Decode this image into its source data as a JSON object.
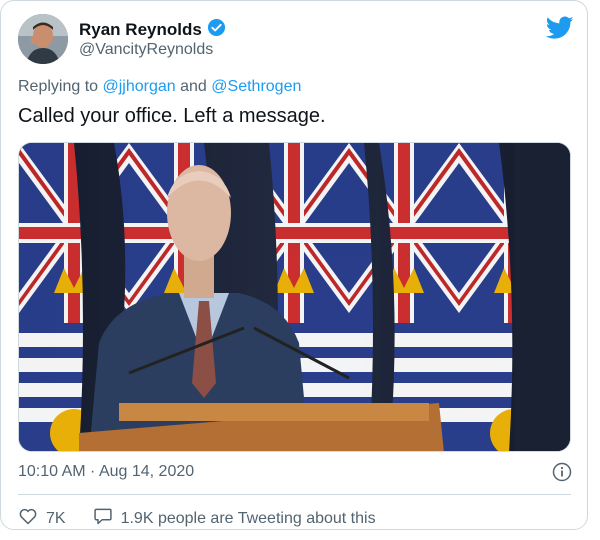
{
  "tweet": {
    "display_name": "Ryan Reynolds",
    "handle": "@VancityReynolds",
    "reply_prefix": "Replying to",
    "reply_user1": "@jjhorgan",
    "reply_and": "and",
    "reply_user2": "@Sethrogen",
    "text": "Called your office. Left a message.",
    "timestamp": "10:10 AM · Aug 14, 2020",
    "likes": "7K",
    "conversation": "1.9K people are Tweeting about this"
  },
  "colors": {
    "accent": "#1d9bf0",
    "secondary_text": "#536471",
    "primary_text": "#0f1419",
    "border": "#cfd9de"
  },
  "icons": [
    "verified-badge-icon",
    "twitter-bird-icon",
    "info-icon",
    "heart-icon",
    "speech-bubble-icon"
  ]
}
